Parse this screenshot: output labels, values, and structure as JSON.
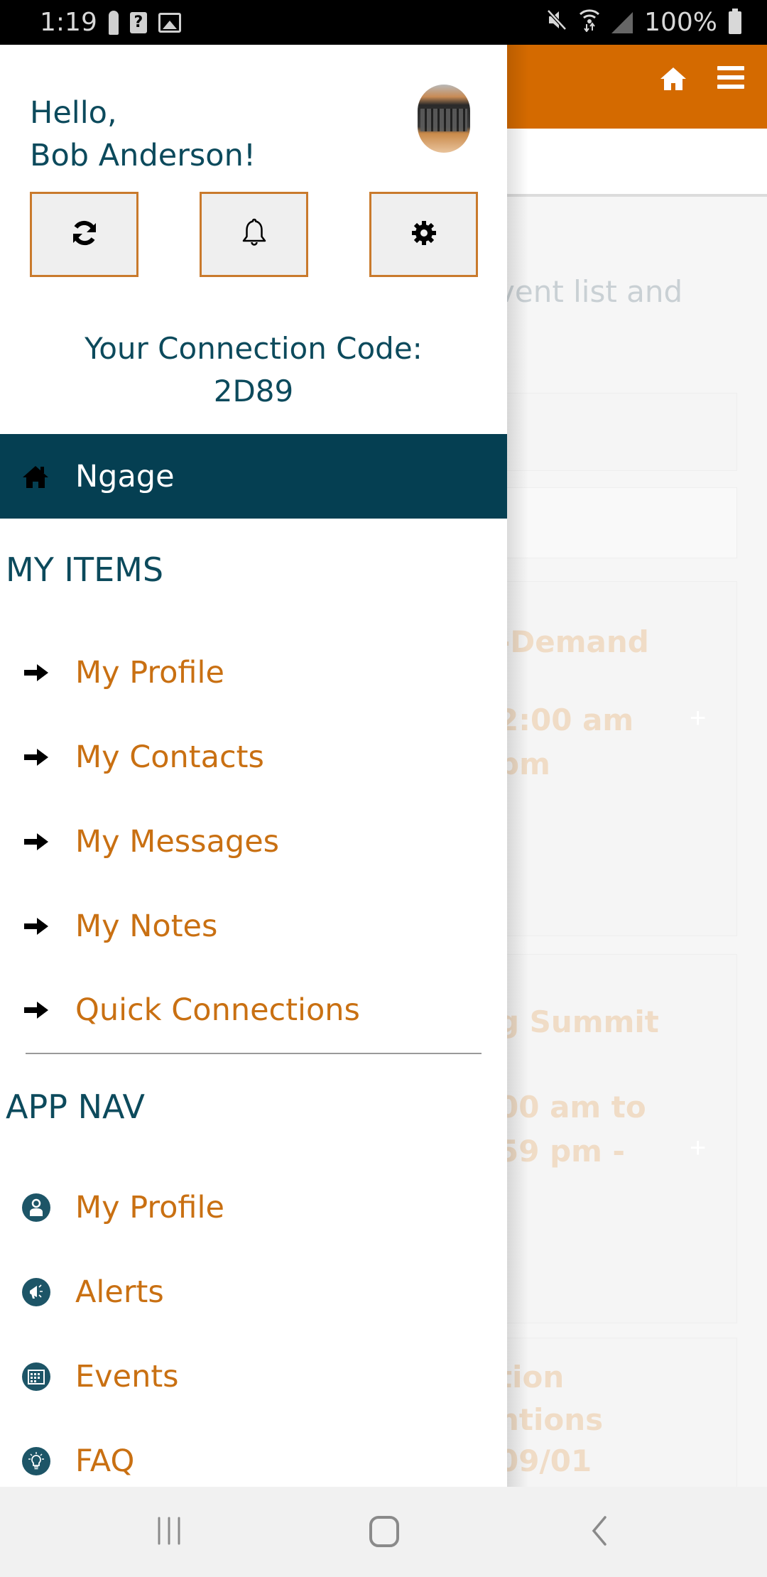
{
  "status_bar": {
    "time": "1:19",
    "battery": "100%",
    "icons_left": [
      "keyhole-icon",
      "unknown-sim-icon",
      "image-icon"
    ],
    "icons_right": [
      "mute-icon",
      "wifi-icon",
      "signal-icon",
      "battery-icon"
    ]
  },
  "drawer": {
    "greeting_line1": "Hello,",
    "greeting_line2": "Bob Anderson!",
    "action_buttons": [
      {
        "icon": "refresh-icon"
      },
      {
        "icon": "bell-icon"
      },
      {
        "icon": "gear-icon"
      }
    ],
    "connection_code_label": "Your Connection Code:",
    "connection_code": "2D89",
    "active_item": {
      "label": "Ngage",
      "icon": "home-icon"
    },
    "sections": [
      {
        "title": "MY ITEMS",
        "items": [
          {
            "label": "My Profile",
            "icon": "arrow-right-icon"
          },
          {
            "label": "My Contacts",
            "icon": "arrow-right-icon"
          },
          {
            "label": "My Messages",
            "icon": "arrow-right-icon"
          },
          {
            "label": "My Notes",
            "icon": "arrow-right-icon"
          },
          {
            "label": "Quick Connections",
            "icon": "arrow-right-icon"
          }
        ]
      },
      {
        "title": "APP NAV",
        "items": [
          {
            "label": "My Profile",
            "icon": "user-circle-icon"
          },
          {
            "label": "Alerts",
            "icon": "megaphone-icon"
          },
          {
            "label": "Events",
            "icon": "calendar-icon"
          },
          {
            "label": "FAQ",
            "icon": "lightbulb-icon"
          }
        ]
      }
    ]
  },
  "background_page": {
    "intro_fragment": "vent list and",
    "cards": [
      {
        "line1": "-Demand",
        "line2": "2:00 am",
        "line3": " pm"
      },
      {
        "line1": "g Summit",
        "line2": "00 am to",
        "line3": "59 pm -"
      },
      {
        "line1": "tion",
        "line2": "ntions",
        "line3": "09/01"
      }
    ]
  },
  "colors": {
    "brand_orange": "#d46a00",
    "brand_teal": "#053f52",
    "link_orange": "#c97012"
  }
}
